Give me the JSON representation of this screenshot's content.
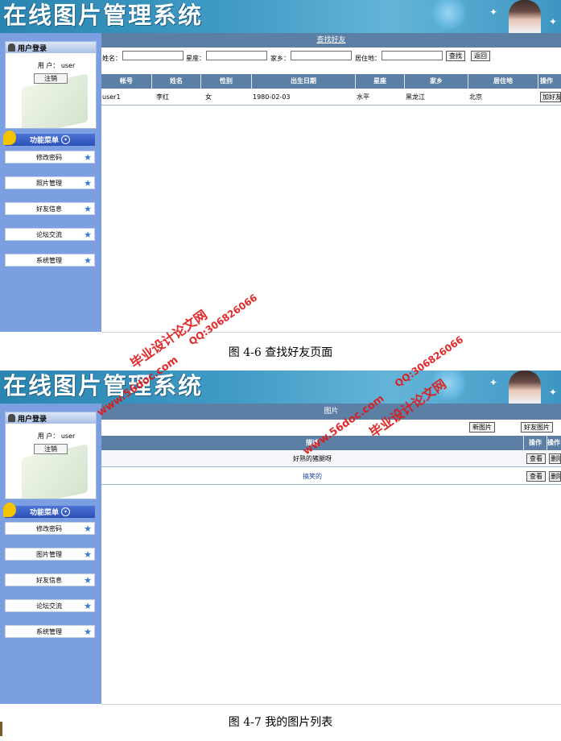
{
  "app_title": "在线图片管理系统",
  "screen1": {
    "login": {
      "header": "用户登录",
      "user_label": "用 户：",
      "username": "user",
      "logout": "注销"
    },
    "menu": {
      "header": "功能菜单",
      "items": [
        "修改密码",
        "照片管理",
        "好友信息",
        "论坛交流",
        "系统管理"
      ]
    },
    "section_title": "查找好友",
    "search": {
      "name_label": "姓名：",
      "constellation_label": "星座：",
      "hometown_label": "家乡：",
      "residence_label": "居住地：",
      "find_button": "查找",
      "back_button": "返回"
    },
    "table": {
      "headers": [
        "帐号",
        "姓名",
        "性别",
        "出生日期",
        "星座",
        "家乡",
        "居住地",
        "操作"
      ],
      "rows": [
        {
          "account": "user1",
          "name": "李红",
          "gender": "女",
          "birth": "1980-02-03",
          "constellation": "水平",
          "hometown": "黑龙江",
          "residence": "北京",
          "action": "加好友"
        }
      ]
    },
    "caption": "图 4-6   查找好友页面"
  },
  "screen2": {
    "login": {
      "header": "用户登录",
      "user_label": "用 户：",
      "username": "user",
      "logout": "注销"
    },
    "menu": {
      "header": "功能菜单",
      "items": [
        "修改密码",
        "图片管理",
        "好友信息",
        "论坛交流",
        "系统管理"
      ]
    },
    "section_title": "图片",
    "buttons": {
      "new_picture": "新图片",
      "friend_pictures": "好友图片"
    },
    "table": {
      "headers": [
        "描述",
        "操作",
        "操作"
      ],
      "rows": [
        {
          "desc": "好熟的猪腿呀",
          "view": "查看",
          "delete": "删除"
        },
        {
          "desc": "搞笑的",
          "view": "查看",
          "delete": "删除"
        }
      ]
    },
    "caption": "图 4-7   我的图片列表"
  },
  "watermark": {
    "site": "毕业设计论文网",
    "url": "www.56doc.com",
    "qq": "QQ:306826066"
  }
}
